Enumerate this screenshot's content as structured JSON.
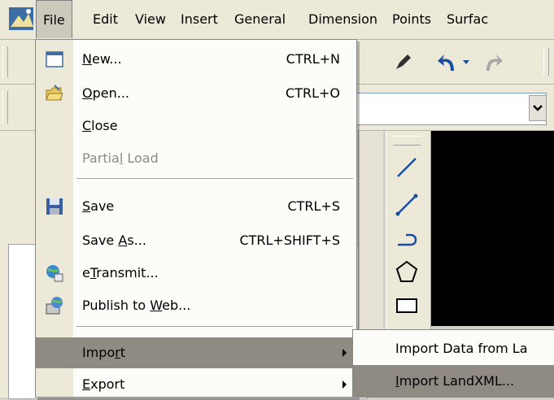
{
  "menubar": {
    "items": [
      {
        "label": "File"
      },
      {
        "label": "Edit"
      },
      {
        "label": "View"
      },
      {
        "label": "Insert"
      },
      {
        "label": "General"
      },
      {
        "label": "Dimension"
      },
      {
        "label": "Points"
      },
      {
        "label": "Surfac"
      }
    ]
  },
  "file_menu": {
    "new": {
      "label": "New...",
      "mnemonic": "N",
      "rest": "ew...",
      "shortcut": "CTRL+N"
    },
    "open": {
      "label": "Open...",
      "mnemonic": "O",
      "rest": "pen...",
      "shortcut": "CTRL+O"
    },
    "close": {
      "label": "Close",
      "mnemonic": "C",
      "rest": "lose"
    },
    "partial_load": {
      "label": "Partial Load",
      "pre": "Partia",
      "mnemonic": "l",
      "rest": " Load"
    },
    "save": {
      "label": "Save",
      "mnemonic": "S",
      "rest": "ave",
      "shortcut": "CTRL+S"
    },
    "save_as": {
      "label": "Save As...",
      "pre": "Save ",
      "mnemonic": "A",
      "rest": "s...",
      "shortcut": "CTRL+SHIFT+S"
    },
    "etransmit": {
      "label": "eTransmit...",
      "pre": "e",
      "mnemonic": "T",
      "rest": "ransmit..."
    },
    "publish": {
      "label": "Publish to Web...",
      "pre": "Publish to ",
      "mnemonic": "W",
      "rest": "eb..."
    },
    "import": {
      "label": "Import",
      "pre": "Impo",
      "mnemonic": "r",
      "rest": "t"
    },
    "export": {
      "label": "Export",
      "mnemonic": "E",
      "rest": "xport"
    }
  },
  "import_submenu": {
    "items": [
      {
        "label": "Import Data from La",
        "pre": "Import Data from La"
      },
      {
        "label": "Import LandXML...",
        "pre": "",
        "mnemonic": "I",
        "rest": "mport LandXML..."
      }
    ]
  },
  "colors": {
    "menu_highlight": "#8f8b82",
    "menu_bg": "#fcfcf9",
    "chrome": "#ece9d8",
    "canvas": "#000000"
  }
}
